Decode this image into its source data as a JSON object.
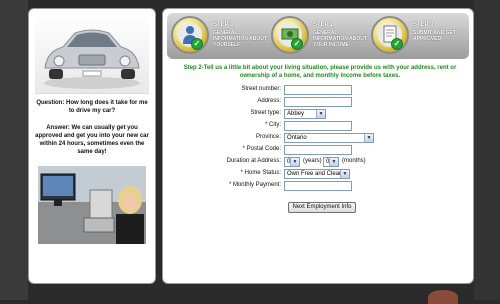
{
  "left": {
    "question": "Question: How long does it take for me to drive my car?",
    "answer": "Answer: We can usually get you approved and get you into your new car within 24 hours, sometimes even the same day!"
  },
  "steps": [
    {
      "title": "STEP 1",
      "desc": "GENERAL INFORMATION ABOUT YOURSELF",
      "completed": true
    },
    {
      "title": "STEP 2",
      "desc": "GENERAL INFORMATION ABOUT YOUR INCOME",
      "completed": true
    },
    {
      "title": "STEP 3",
      "desc": "SUBMIT AND GET APPROVED!",
      "completed": true
    }
  ],
  "instructions": "Step 2-Tell us a little bit about your living situation, please provide us with your address, rent or ownership of a home, and monthly income before taxes.",
  "form": {
    "street_number_label": "Street number:",
    "address_label": "Address:",
    "street_type_label": "Street type:",
    "street_type_value": "Abbey",
    "city_label": "* City:",
    "province_label": "Province:",
    "province_value": "Ontario",
    "postal_code_label": "* Postal Code:",
    "duration_label": "Duration at Address:",
    "duration_years_value": "0",
    "duration_years_unit": "(years)",
    "duration_months_value": "0",
    "duration_months_unit": "(months)",
    "home_status_label": "* Home Status:",
    "home_status_value": "Own Free and Clear",
    "monthly_payment_label": "* Monthly Payment:"
  },
  "buttons": {
    "next": "Next Employment Info"
  },
  "colors": {
    "instructions_text": "#1e8a1e",
    "check_green": "#25a631"
  }
}
